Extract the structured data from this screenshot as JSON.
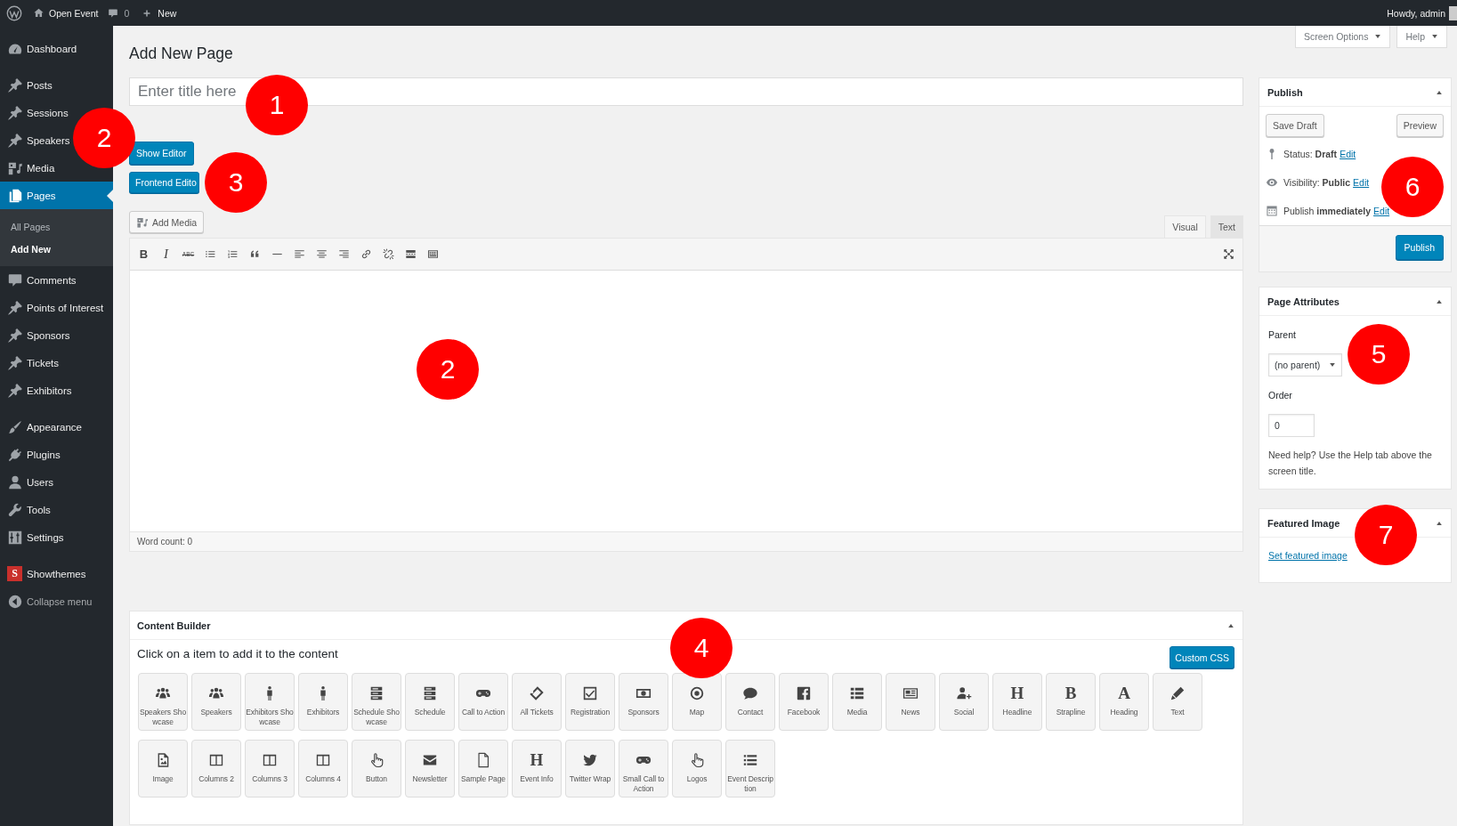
{
  "top_bar": {
    "site_name": "Open Event",
    "comments_count": "0",
    "new_label": "New",
    "greeting": "Howdy, admin"
  },
  "sidebar": {
    "groups": [
      {
        "items": [
          {
            "label": "Dashboard",
            "selected": false
          }
        ]
      },
      {
        "items": [
          {
            "label": "Posts",
            "selected": false
          },
          {
            "label": "Sessions",
            "selected": false
          },
          {
            "label": "Speakers",
            "selected": false
          },
          {
            "label": "Media",
            "selected": false
          },
          {
            "label": "Pages",
            "selected": true,
            "children": [
              {
                "label": "All Pages",
                "selected": false
              },
              {
                "label": "Add New",
                "selected": true
              }
            ]
          },
          {
            "label": "Comments",
            "selected": false
          },
          {
            "label": "Points of Interest",
            "selected": false
          },
          {
            "label": "Sponsors",
            "selected": false
          },
          {
            "label": "Tickets",
            "selected": false
          },
          {
            "label": "Exhibitors",
            "selected": false
          }
        ]
      },
      {
        "items": [
          {
            "label": "Appearance",
            "selected": false
          },
          {
            "label": "Plugins",
            "selected": false
          },
          {
            "label": "Users",
            "selected": false
          },
          {
            "label": "Tools",
            "selected": false
          },
          {
            "label": "Settings",
            "selected": false
          }
        ]
      },
      {
        "items": [
          {
            "label": "Showthemes",
            "selected": false,
            "badge": "S"
          }
        ]
      }
    ],
    "collapse_label": "Collapse menu"
  },
  "screen_meta": {
    "tabs": [
      "Screen Options",
      "Help"
    ]
  },
  "page_title": "Add New Page",
  "title_field": {
    "placeholder": "Enter title here"
  },
  "editor_buttons": [
    "Show Editor",
    "Frontend Edito"
  ],
  "editor": {
    "add_media": "Add Media",
    "tabs": [
      {
        "label": "Visual",
        "selected": true
      },
      {
        "label": "Text",
        "selected": false
      }
    ],
    "toolbar_glyphs": [
      "B",
      "I",
      "ABC"
    ],
    "word_count": "Word count: 0"
  },
  "content_builder": {
    "title": "Content Builder",
    "hint": "Click on a item to add it to the content",
    "custom_css": "Custom CSS",
    "rows": [
      [
        {
          "label": "Speakers Showcase"
        },
        {
          "label": "Speakers"
        },
        {
          "label": "Exhibitors Showcase"
        },
        {
          "label": "Exhibitors"
        },
        {
          "label": "Schedule Showcase"
        },
        {
          "label": "Schedule"
        },
        {
          "label": "Call to Action"
        },
        {
          "label": "All Tickets"
        },
        {
          "label": "Registration"
        },
        {
          "label": "Sponsors"
        },
        {
          "label": "Map"
        },
        {
          "label": "Contact"
        },
        {
          "label": "Facebook"
        },
        {
          "label": "Media"
        },
        {
          "label": "News"
        },
        {
          "label": "Social"
        },
        {
          "label": "Headline",
          "glyph": "H"
        },
        {
          "label": "Strapline",
          "glyph": "B"
        },
        {
          "label": "Heading",
          "glyph": "A"
        },
        {
          "label": "Text"
        }
      ],
      [
        {
          "label": "Image"
        },
        {
          "label": "Columns 2"
        },
        {
          "label": "Columns 3"
        },
        {
          "label": "Columns 4"
        },
        {
          "label": "Button"
        },
        {
          "label": "Newsletter"
        },
        {
          "label": "Sample Page"
        },
        {
          "label": "Event Info",
          "glyph": "H"
        },
        {
          "label": "Twitter Wrap"
        },
        {
          "label": "Small Call to Action"
        },
        {
          "label": "Logos"
        },
        {
          "label": "Event Description"
        }
      ]
    ]
  },
  "publish": {
    "title": "Publish",
    "save_draft": "Save Draft",
    "preview": "Preview",
    "rows": [
      {
        "text": "Status: **Draft**",
        "link": "Edit"
      },
      {
        "text": "Visibility: **Public**",
        "link": "Edit"
      },
      {
        "text": "Publish **immediately**",
        "link": "Edit"
      }
    ],
    "publish_button": "Publish"
  },
  "page_attributes": {
    "title": "Page Attributes",
    "parent_label": "Parent",
    "parent_value": "(no parent)",
    "order_label": "Order",
    "order_value": "0",
    "help": "Need help? Use the Help tab above the screen title."
  },
  "featured_image": {
    "title": "Featured Image",
    "link": "Set featured image"
  },
  "annotations": [
    "1",
    "2",
    "3",
    "2",
    "4",
    "5",
    "6",
    "7"
  ]
}
